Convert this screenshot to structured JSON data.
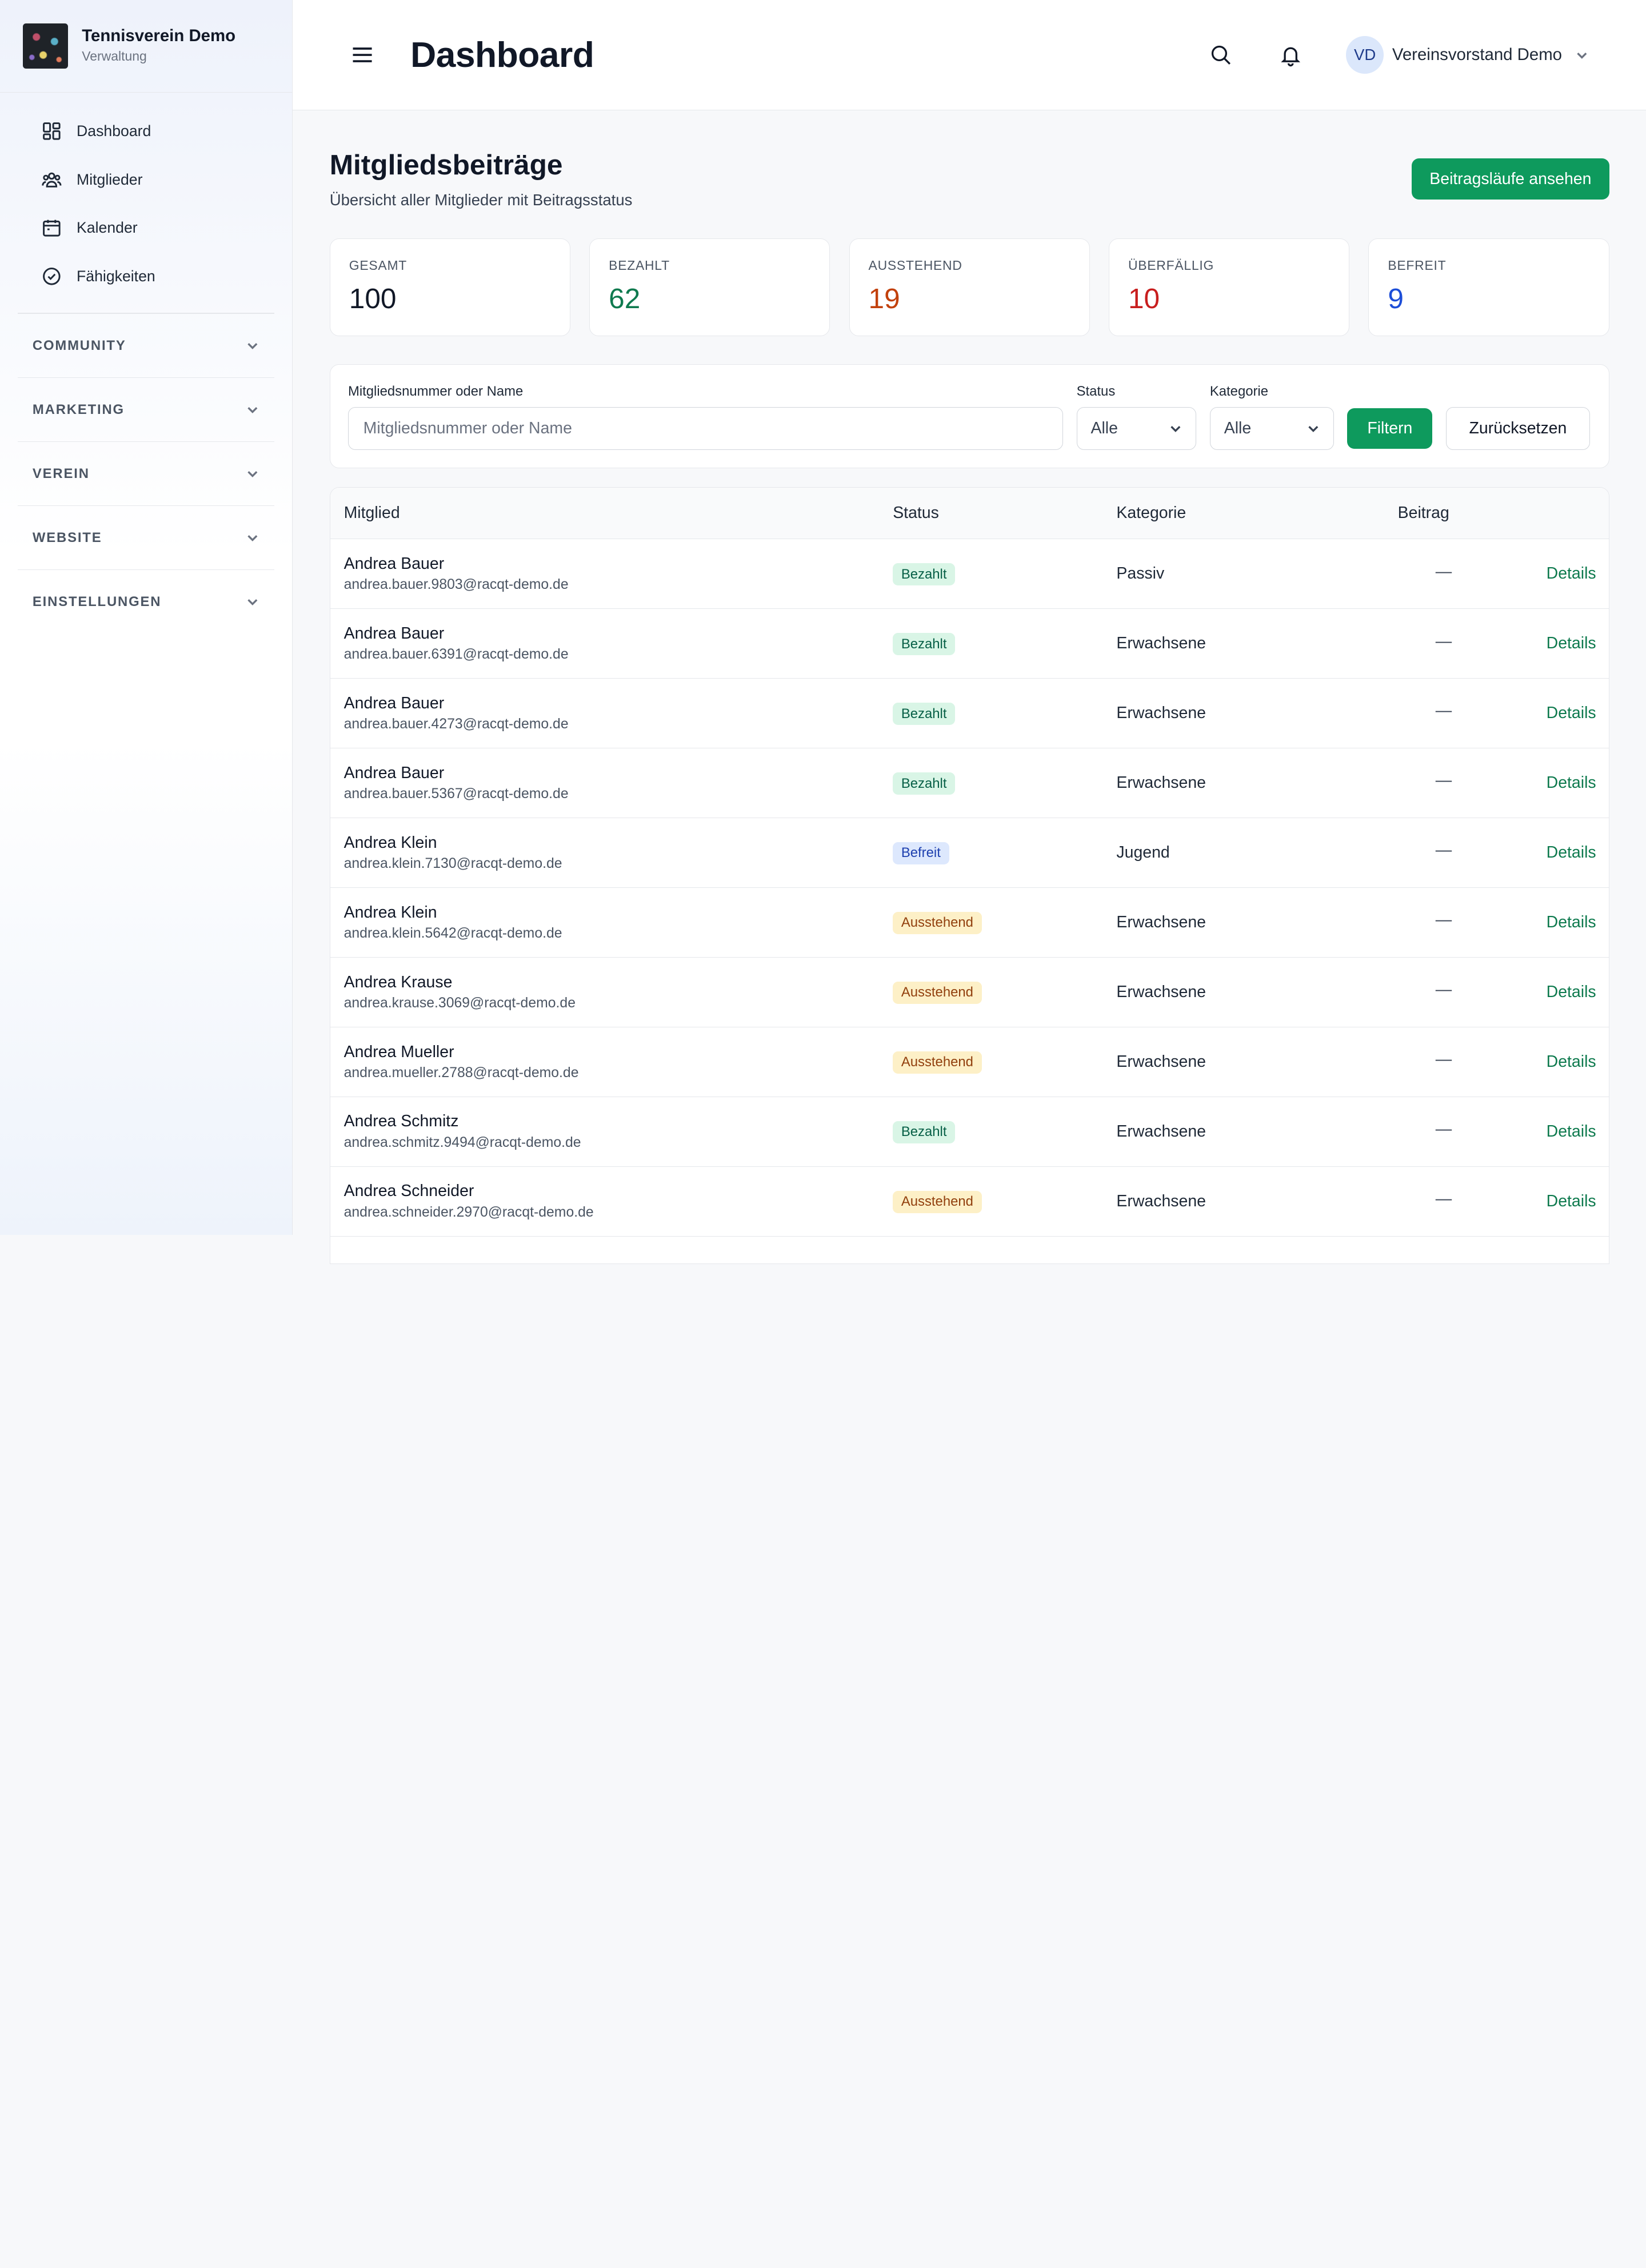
{
  "brand": {
    "title": "Tennisverein Demo",
    "subtitle": "Verwaltung"
  },
  "nav": [
    {
      "label": "Dashboard",
      "icon": "dashboard-icon"
    },
    {
      "label": "Mitglieder",
      "icon": "users-icon"
    },
    {
      "label": "Kalender",
      "icon": "calendar-icon"
    },
    {
      "label": "Fähigkeiten",
      "icon": "check-circle-icon"
    }
  ],
  "sections": [
    "COMMUNITY",
    "MARKETING",
    "VEREIN",
    "WEBSITE",
    "EINSTELLUNGEN"
  ],
  "header": {
    "title": "Dashboard",
    "user_initials": "VD",
    "user_name": "Vereinsvorstand Demo"
  },
  "page": {
    "title": "Mitgliedsbeiträge",
    "subtitle": "Übersicht aller Mitglieder mit Beitragsstatus",
    "action_label": "Beitragsläufe ansehen"
  },
  "stats": [
    {
      "label": "Gesamt",
      "value": "100",
      "color": "#111827"
    },
    {
      "label": "Bezahlt",
      "value": "62",
      "color": "#0f7a4f"
    },
    {
      "label": "Ausstehend",
      "value": "19",
      "color": "#c2410c"
    },
    {
      "label": "Überfällig",
      "value": "10",
      "color": "#c81e1e"
    },
    {
      "label": "Befreit",
      "value": "9",
      "color": "#1d4ed8"
    }
  ],
  "filter": {
    "search_label": "Mitgliedsnummer oder Name",
    "search_placeholder": "Mitgliedsnummer oder Name",
    "status_label": "Status",
    "status_value": "Alle",
    "category_label": "Kategorie",
    "category_value": "Alle",
    "filter_button": "Filtern",
    "reset_button": "Zurücksetzen"
  },
  "table": {
    "columns": [
      "Mitglied",
      "Status",
      "Kategorie",
      "Beitrag"
    ],
    "link_label": "Details",
    "rows": [
      {
        "name": "Andrea Bauer",
        "email": "andrea.bauer.9803@racqt-demo.de",
        "status": "Bezahlt",
        "category": "Passiv",
        "fee": "—"
      },
      {
        "name": "Andrea Bauer",
        "email": "andrea.bauer.6391@racqt-demo.de",
        "status": "Bezahlt",
        "category": "Erwachsene",
        "fee": "—"
      },
      {
        "name": "Andrea Bauer",
        "email": "andrea.bauer.4273@racqt-demo.de",
        "status": "Bezahlt",
        "category": "Erwachsene",
        "fee": "—"
      },
      {
        "name": "Andrea Bauer",
        "email": "andrea.bauer.5367@racqt-demo.de",
        "status": "Bezahlt",
        "category": "Erwachsene",
        "fee": "—"
      },
      {
        "name": "Andrea Klein",
        "email": "andrea.klein.7130@racqt-demo.de",
        "status": "Befreit",
        "category": "Jugend",
        "fee": "—"
      },
      {
        "name": "Andrea Klein",
        "email": "andrea.klein.5642@racqt-demo.de",
        "status": "Ausstehend",
        "category": "Erwachsene",
        "fee": "—"
      },
      {
        "name": "Andrea Krause",
        "email": "andrea.krause.3069@racqt-demo.de",
        "status": "Ausstehend",
        "category": "Erwachsene",
        "fee": "—"
      },
      {
        "name": "Andrea Mueller",
        "email": "andrea.mueller.2788@racqt-demo.de",
        "status": "Ausstehend",
        "category": "Erwachsene",
        "fee": "—"
      },
      {
        "name": "Andrea Schmitz",
        "email": "andrea.schmitz.9494@racqt-demo.de",
        "status": "Bezahlt",
        "category": "Erwachsene",
        "fee": "—"
      },
      {
        "name": "Andrea Schneider",
        "email": "andrea.schneider.2970@racqt-demo.de",
        "status": "Ausstehend",
        "category": "Erwachsene",
        "fee": "—"
      }
    ]
  }
}
